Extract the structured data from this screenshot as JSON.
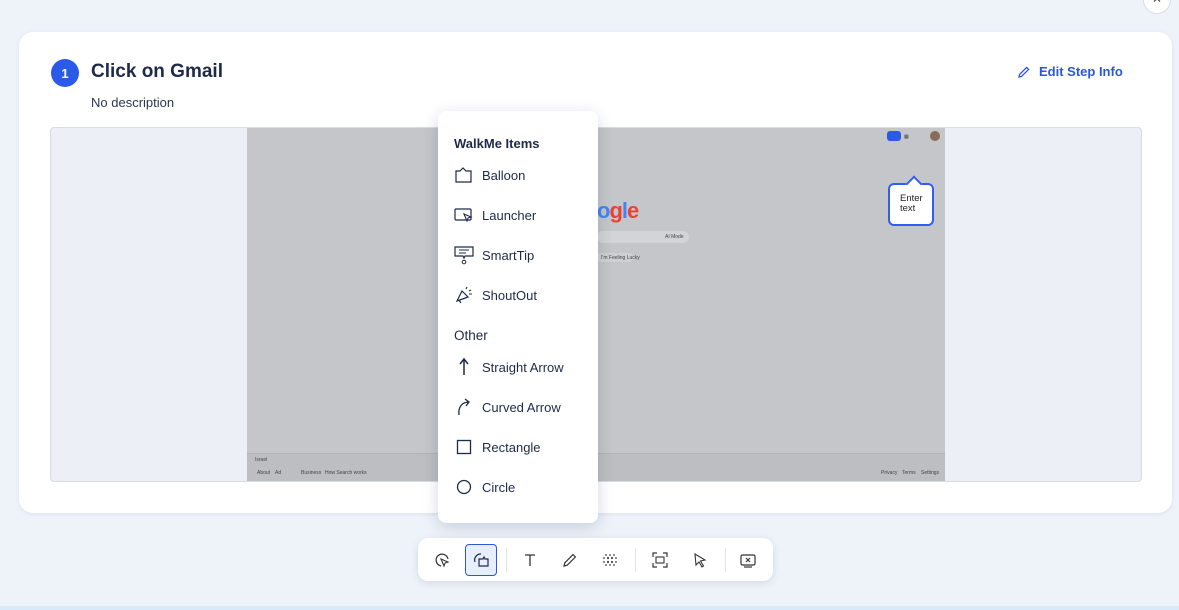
{
  "step": {
    "number": "1",
    "title": "Click on Gmail",
    "description": "No description",
    "edit_label": "Edit Step Info"
  },
  "screenshot": {
    "logo_text": "ogle",
    "balloon_text": "Enter\ntext",
    "footer_left": "Israel",
    "footer_links": [
      "About",
      "Ad",
      "Business",
      "How Search works"
    ],
    "footer_right": [
      "Privacy",
      "Terms",
      "Settings"
    ],
    "search_button_left": "I'm Feeling Lucky",
    "ai_mode": "AI Mode"
  },
  "menu": {
    "section1": "WalkMe Items",
    "items1": [
      {
        "label": "Balloon",
        "icon": "balloon-icon"
      },
      {
        "label": "Launcher",
        "icon": "launcher-icon"
      },
      {
        "label": "SmartTip",
        "icon": "smarttip-icon"
      },
      {
        "label": "ShoutOut",
        "icon": "shoutout-icon"
      }
    ],
    "section2": "Other",
    "items2": [
      {
        "label": "Straight Arrow",
        "icon": "straight-arrow-icon"
      },
      {
        "label": "Curved Arrow",
        "icon": "curved-arrow-icon"
      },
      {
        "label": "Rectangle",
        "icon": "rectangle-icon"
      },
      {
        "label": "Circle",
        "icon": "circle-icon"
      }
    ]
  },
  "toolbar": {
    "tools": [
      "pointer-click-tool",
      "walkme-items-tool",
      "text-tool",
      "pen-tool",
      "blur-tool",
      "capture-tool",
      "cursor-tool",
      "clear-tool"
    ]
  },
  "colors": {
    "accent": "#2b59e8",
    "background": "#eef2f9",
    "text": "#1e2a4a"
  }
}
